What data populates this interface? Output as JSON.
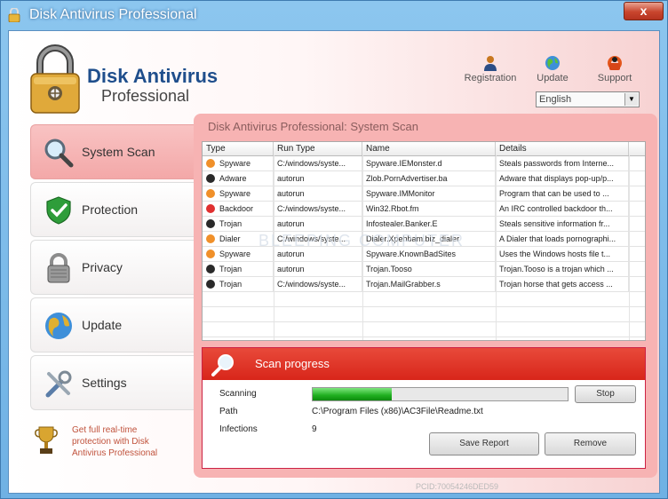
{
  "window": {
    "title": "Disk Antivirus Professional",
    "close_label": "x"
  },
  "brand": {
    "line1": "Disk Antivirus",
    "line2": "Professional"
  },
  "top_links": [
    {
      "label": "Registration",
      "icon": "user-icon"
    },
    {
      "label": "Update",
      "icon": "globe-icon"
    },
    {
      "label": "Support",
      "icon": "lifebuoy-icon"
    }
  ],
  "language": {
    "selected": "English"
  },
  "nav": [
    {
      "label": "System Scan",
      "icon": "magnifier-icon",
      "active": true
    },
    {
      "label": "Protection",
      "icon": "shield-check-icon",
      "active": false
    },
    {
      "label": "Privacy",
      "icon": "padlock-icon",
      "active": false
    },
    {
      "label": "Update",
      "icon": "globe-icon",
      "active": false
    },
    {
      "label": "Settings",
      "icon": "tools-icon",
      "active": false
    }
  ],
  "promo": {
    "text": "Get full real-time protection with Disk Antivirus Professional"
  },
  "panel": {
    "title": "Disk Antivirus Professional: System Scan"
  },
  "table": {
    "columns": [
      "Type",
      "Run Type",
      "Name",
      "Details"
    ],
    "rows": [
      {
        "severity": "orange",
        "type": "Spyware",
        "run_type": "C:/windows/syste...",
        "name": "Spyware.IEMonster.d",
        "details": "Steals passwords from Interne..."
      },
      {
        "severity": "black",
        "type": "Adware",
        "run_type": "autorun",
        "name": "Zlob.PornAdvertiser.ba",
        "details": "Adware that displays pop-up/p..."
      },
      {
        "severity": "orange",
        "type": "Spyware",
        "run_type": "autorun",
        "name": "Spyware.IMMonitor",
        "details": "Program that can be used to ..."
      },
      {
        "severity": "red",
        "type": "Backdoor",
        "run_type": "C:/windows/syste...",
        "name": "Win32.Rbot.fm",
        "details": "An IRC controlled backdoor th..."
      },
      {
        "severity": "black",
        "type": "Trojan",
        "run_type": "autorun",
        "name": "Infostealer.Banker.E",
        "details": "Steals sensitive information fr..."
      },
      {
        "severity": "orange",
        "type": "Dialer",
        "run_type": "C:/windows/syste...",
        "name": "Dialer.Xpehbam.biz_dialer",
        "details": "A Dialer that loads pornographi..."
      },
      {
        "severity": "orange",
        "type": "Spyware",
        "run_type": "autorun",
        "name": "Spyware.KnownBadSites",
        "details": "Uses the Windows hosts file t..."
      },
      {
        "severity": "black",
        "type": "Trojan",
        "run_type": "autorun",
        "name": "Trojan.Tooso",
        "details": "Trojan.Tooso is a trojan which ..."
      },
      {
        "severity": "black",
        "type": "Trojan",
        "run_type": "C:/windows/syste...",
        "name": "Trojan.MailGrabber.s",
        "details": "Trojan horse that gets access ..."
      }
    ]
  },
  "scan": {
    "heading": "Scan progress",
    "scanning_label": "Scanning",
    "path_label": "Path",
    "path_value": "C:\\Program Files (x86)\\AC3File\\Readme.txt",
    "infections_label": "Infections",
    "infections_value": "9",
    "progress_fraction": 0.31,
    "stop_label": "Stop",
    "save_label": "Save Report",
    "remove_label": "Remove"
  },
  "watermark": "BLEEPING COMPUTER",
  "pcid": "PCID:70054246DED59",
  "colors": {
    "severity_orange": "#f0902a",
    "severity_black": "#2a2a2a",
    "severity_red": "#e03030",
    "accent_red": "#d8261a",
    "progress_green": "#1fae1f"
  }
}
